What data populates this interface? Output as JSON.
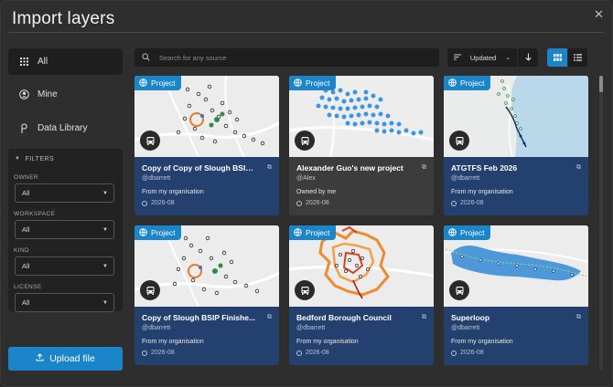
{
  "dialog": {
    "title": "Import layers"
  },
  "sidebar": {
    "items": [
      {
        "label": "All",
        "icon": "grid-icon"
      },
      {
        "label": "Mine",
        "icon": "user-icon"
      },
      {
        "label": "Data Library",
        "icon": "pin-icon"
      }
    ],
    "filters": {
      "heading": "FILTERS",
      "groups": [
        {
          "label": "OWNER",
          "value": "All"
        },
        {
          "label": "WORKSPACE",
          "value": "All"
        },
        {
          "label": "KIND",
          "value": "All"
        },
        {
          "label": "LICENSE",
          "value": "All"
        }
      ]
    },
    "upload_label": "Upload file"
  },
  "toolbar": {
    "search_placeholder": "Search for any source",
    "sort_label": "Updated",
    "accent": "#1a85c8"
  },
  "cards": [
    {
      "badge": "Project",
      "title": "Copy of Copy of Slough BSIP Fi...",
      "user": "@dbarrett",
      "source": "From my organisation",
      "date": "2026-08"
    },
    {
      "badge": "Project",
      "title": "Alexander Guo's new project",
      "user": "@Alex",
      "source": "Owned by me",
      "date": "2026-08"
    },
    {
      "badge": "Project",
      "title": "ATGTFS Feb 2026",
      "user": "@dbarrett",
      "source": "From my organisation",
      "date": "2026-08"
    },
    {
      "badge": "Project",
      "title": "Copy of Slough BSIP Finishe...",
      "user": "@dbarrett",
      "source": "From my organisation",
      "date": "2026-08"
    },
    {
      "badge": "Project",
      "title": "Bedford Borough Council",
      "user": "@dbarrett",
      "source": "From my organisation",
      "date": "2026-08"
    },
    {
      "badge": "Project",
      "title": "Superloop",
      "user": "@dbarrett",
      "source": "From my organisation",
      "date": "2026-08"
    }
  ]
}
